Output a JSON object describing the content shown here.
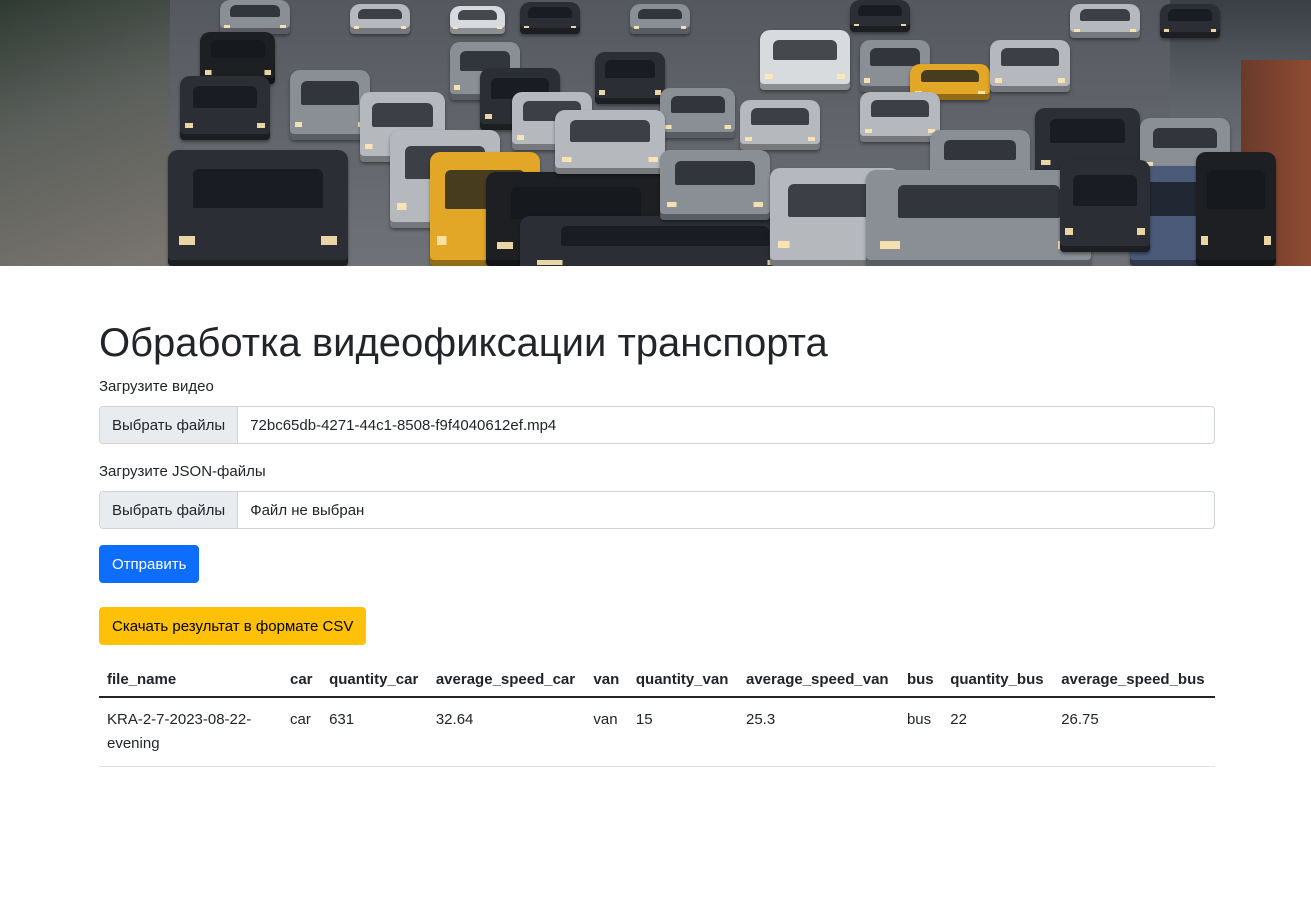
{
  "page": {
    "title": "Обработка видеофиксации транспорта"
  },
  "hero": {
    "icon": "traffic-photo"
  },
  "video_upload": {
    "label": "Загрузите видео",
    "button_label": "Выбрать файлы",
    "file_name": "72bc65db-4271-44c1-8508-f9f4040612ef.mp4"
  },
  "json_upload": {
    "label": "Загрузите JSON-файлы",
    "button_label": "Выбрать файлы",
    "file_name": "Файл не выбран"
  },
  "submit_button": "Отправить",
  "download_button": "Скачать результат в формате CSV",
  "colors": {
    "primary": "#0d6efd",
    "warning": "#ffc107"
  },
  "table": {
    "columns": [
      "file_name",
      "car",
      "quantity_car",
      "average_speed_car",
      "van",
      "quantity_van",
      "average_speed_van",
      "bus",
      "quantity_bus",
      "average_speed_bus"
    ],
    "rows": [
      [
        "KRA-2-7-2023-08-22-evening",
        "car",
        "631",
        "32.64",
        "van",
        "15",
        "25.3",
        "bus",
        "22",
        "26.75"
      ]
    ]
  }
}
